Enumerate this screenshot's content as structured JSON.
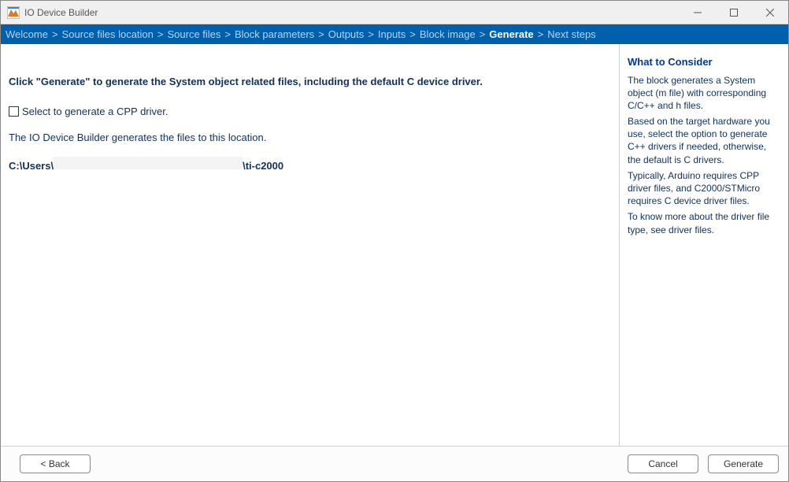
{
  "window": {
    "title": "IO Device Builder"
  },
  "breadcrumb": {
    "items": [
      {
        "label": "Welcome",
        "current": false
      },
      {
        "label": "Source files location",
        "current": false
      },
      {
        "label": "Source files",
        "current": false
      },
      {
        "label": "Block parameters",
        "current": false
      },
      {
        "label": "Outputs",
        "current": false
      },
      {
        "label": "Inputs",
        "current": false
      },
      {
        "label": "Block image",
        "current": false
      },
      {
        "label": "Generate",
        "current": true
      },
      {
        "label": "Next steps",
        "current": false
      }
    ]
  },
  "main": {
    "headline": "Click \"Generate\" to generate the System object related files, including the default C device driver.",
    "checkbox_label": "Select to generate a CPP driver.",
    "checkbox_value": false,
    "location_text": "The IO Device Builder generates the files to this location.",
    "path_prefix": "C:\\Users\\",
    "path_suffix": "\\ti-c2000"
  },
  "sidebar": {
    "heading": "What to Consider",
    "paragraphs": [
      "The block generates a System object (m file) with corresponding C/C++ and h files.",
      "Based on the target hardware you use, select the option to generate C++ drivers if needed, otherwise, the default is C drivers.",
      "Typically, Arduino requires CPP driver files, and C2000/STMicro requires C device driver files.",
      "To know more about the driver file type, see driver files."
    ]
  },
  "footer": {
    "back_label": "Back",
    "cancel_label": "Cancel",
    "generate_label": "Generate"
  }
}
